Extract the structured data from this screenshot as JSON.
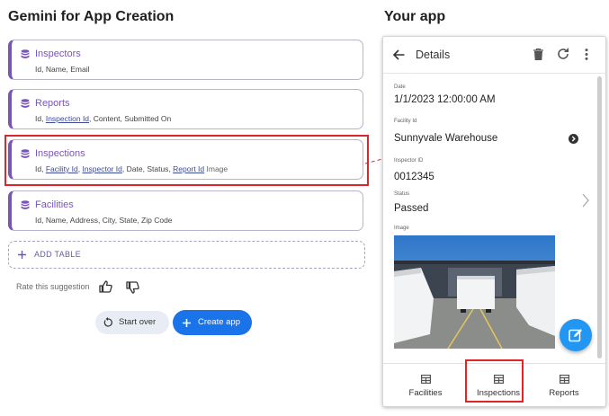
{
  "left_title": "Gemini for App Creation",
  "right_title": "Your app",
  "tables": [
    {
      "name": "Inspectors",
      "fields": [
        "Id",
        "Name",
        "Email"
      ]
    },
    {
      "name": "Reports",
      "fields": [
        "Id",
        "Inspection Id",
        "Content",
        "Submitted On"
      ]
    },
    {
      "name": "Inspections",
      "fields": [
        "Id",
        "Facility Id",
        "Inspector Id",
        "Date",
        "Status",
        "Report Id",
        "Image"
      ]
    },
    {
      "name": "Facilities",
      "fields": [
        "Id",
        "Name",
        "Address",
        "City",
        "State",
        "Zip Code"
      ]
    }
  ],
  "add_table_label": "ADD TABLE",
  "rate_label": "Rate this suggestion",
  "start_over_label": "Start over",
  "create_app_label": "Create app",
  "app": {
    "header_title": "Details",
    "date_label": "Date",
    "date_value": "1/1/2023 12:00:00 AM",
    "facility_label": "Facility Id",
    "facility_value": "Sunnyvale Warehouse",
    "inspector_label": "Inspector ID",
    "inspector_value": "0012345",
    "status_label": "Status",
    "status_value": "Passed",
    "image_label": "Image",
    "tabs": [
      "Facilities",
      "Inspections",
      "Reports"
    ]
  },
  "colors": {
    "accent_purple": "#7a55b8",
    "highlight_red": "#e0242b",
    "primary_blue": "#1a73e8"
  },
  "icons": [
    "database-icon",
    "plus-icon",
    "thumb-up-icon",
    "thumb-down-icon",
    "restart-icon",
    "back-arrow-icon",
    "trash-icon",
    "refresh-icon",
    "more-vert-icon",
    "chevron-right-icon",
    "edit-icon",
    "table-grid-icon"
  ]
}
